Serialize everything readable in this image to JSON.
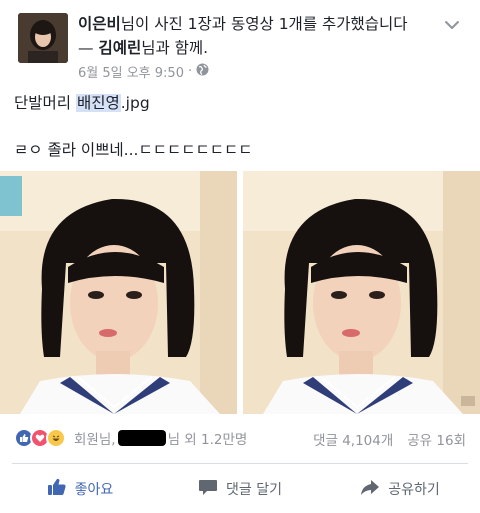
{
  "post": {
    "author": "이은비",
    "headline_mid": "님이 사진 1장과 동영상 1개를 추가했습니다",
    "dash": " — ",
    "with_name": "김예린",
    "with_suffix": "님과 함께.",
    "timestamp": "6월 5일 오후 9:50",
    "dot": "·",
    "text_prefix": "단발머리 ",
    "text_highlight": "배진영",
    "text_suffix": ".jpg",
    "text_line2": "ㄹㅇ 졸라 이쁘네...ㄷㄷㄷㄷㄷㄷㄷㄷ"
  },
  "reactions": {
    "names_prefix": "회원님,",
    "names_suffix": "님 외 1.2만명",
    "comments": "댓글 4,104개",
    "shares": "공유 16회"
  },
  "actions": {
    "like": "좋아요",
    "comment": "댓글 달기",
    "share": "공유하기"
  },
  "colors": {
    "facebook_blue": "#4267b2",
    "meta_gray": "#90949c",
    "highlight": "#d5e1f6"
  }
}
